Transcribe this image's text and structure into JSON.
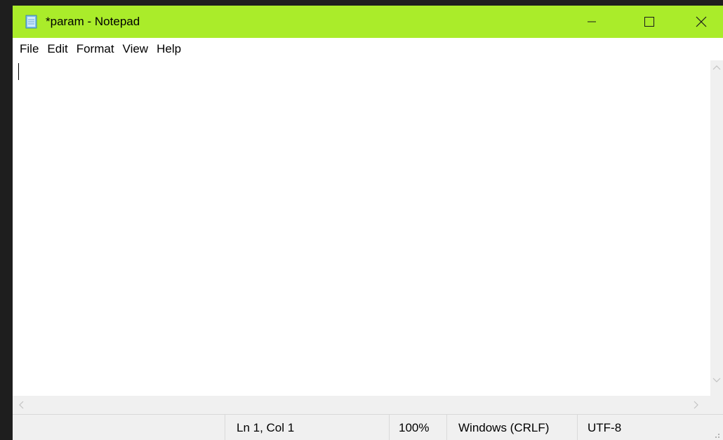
{
  "window": {
    "title": "*param - Notepad",
    "titlebar_color": "#aaec2a",
    "app_icon": "notepad-icon"
  },
  "caption_buttons": {
    "minimize_icon": "minimize-icon",
    "maximize_icon": "maximize-icon",
    "close_icon": "close-icon"
  },
  "menu": {
    "items": [
      {
        "label": "File"
      },
      {
        "label": "Edit"
      },
      {
        "label": "Format"
      },
      {
        "label": "View"
      },
      {
        "label": "Help"
      }
    ]
  },
  "editor": {
    "content": ""
  },
  "status": {
    "position": "Ln 1, Col 1",
    "zoom": "100%",
    "line_endings": "Windows (CRLF)",
    "encoding": "UTF-8"
  }
}
